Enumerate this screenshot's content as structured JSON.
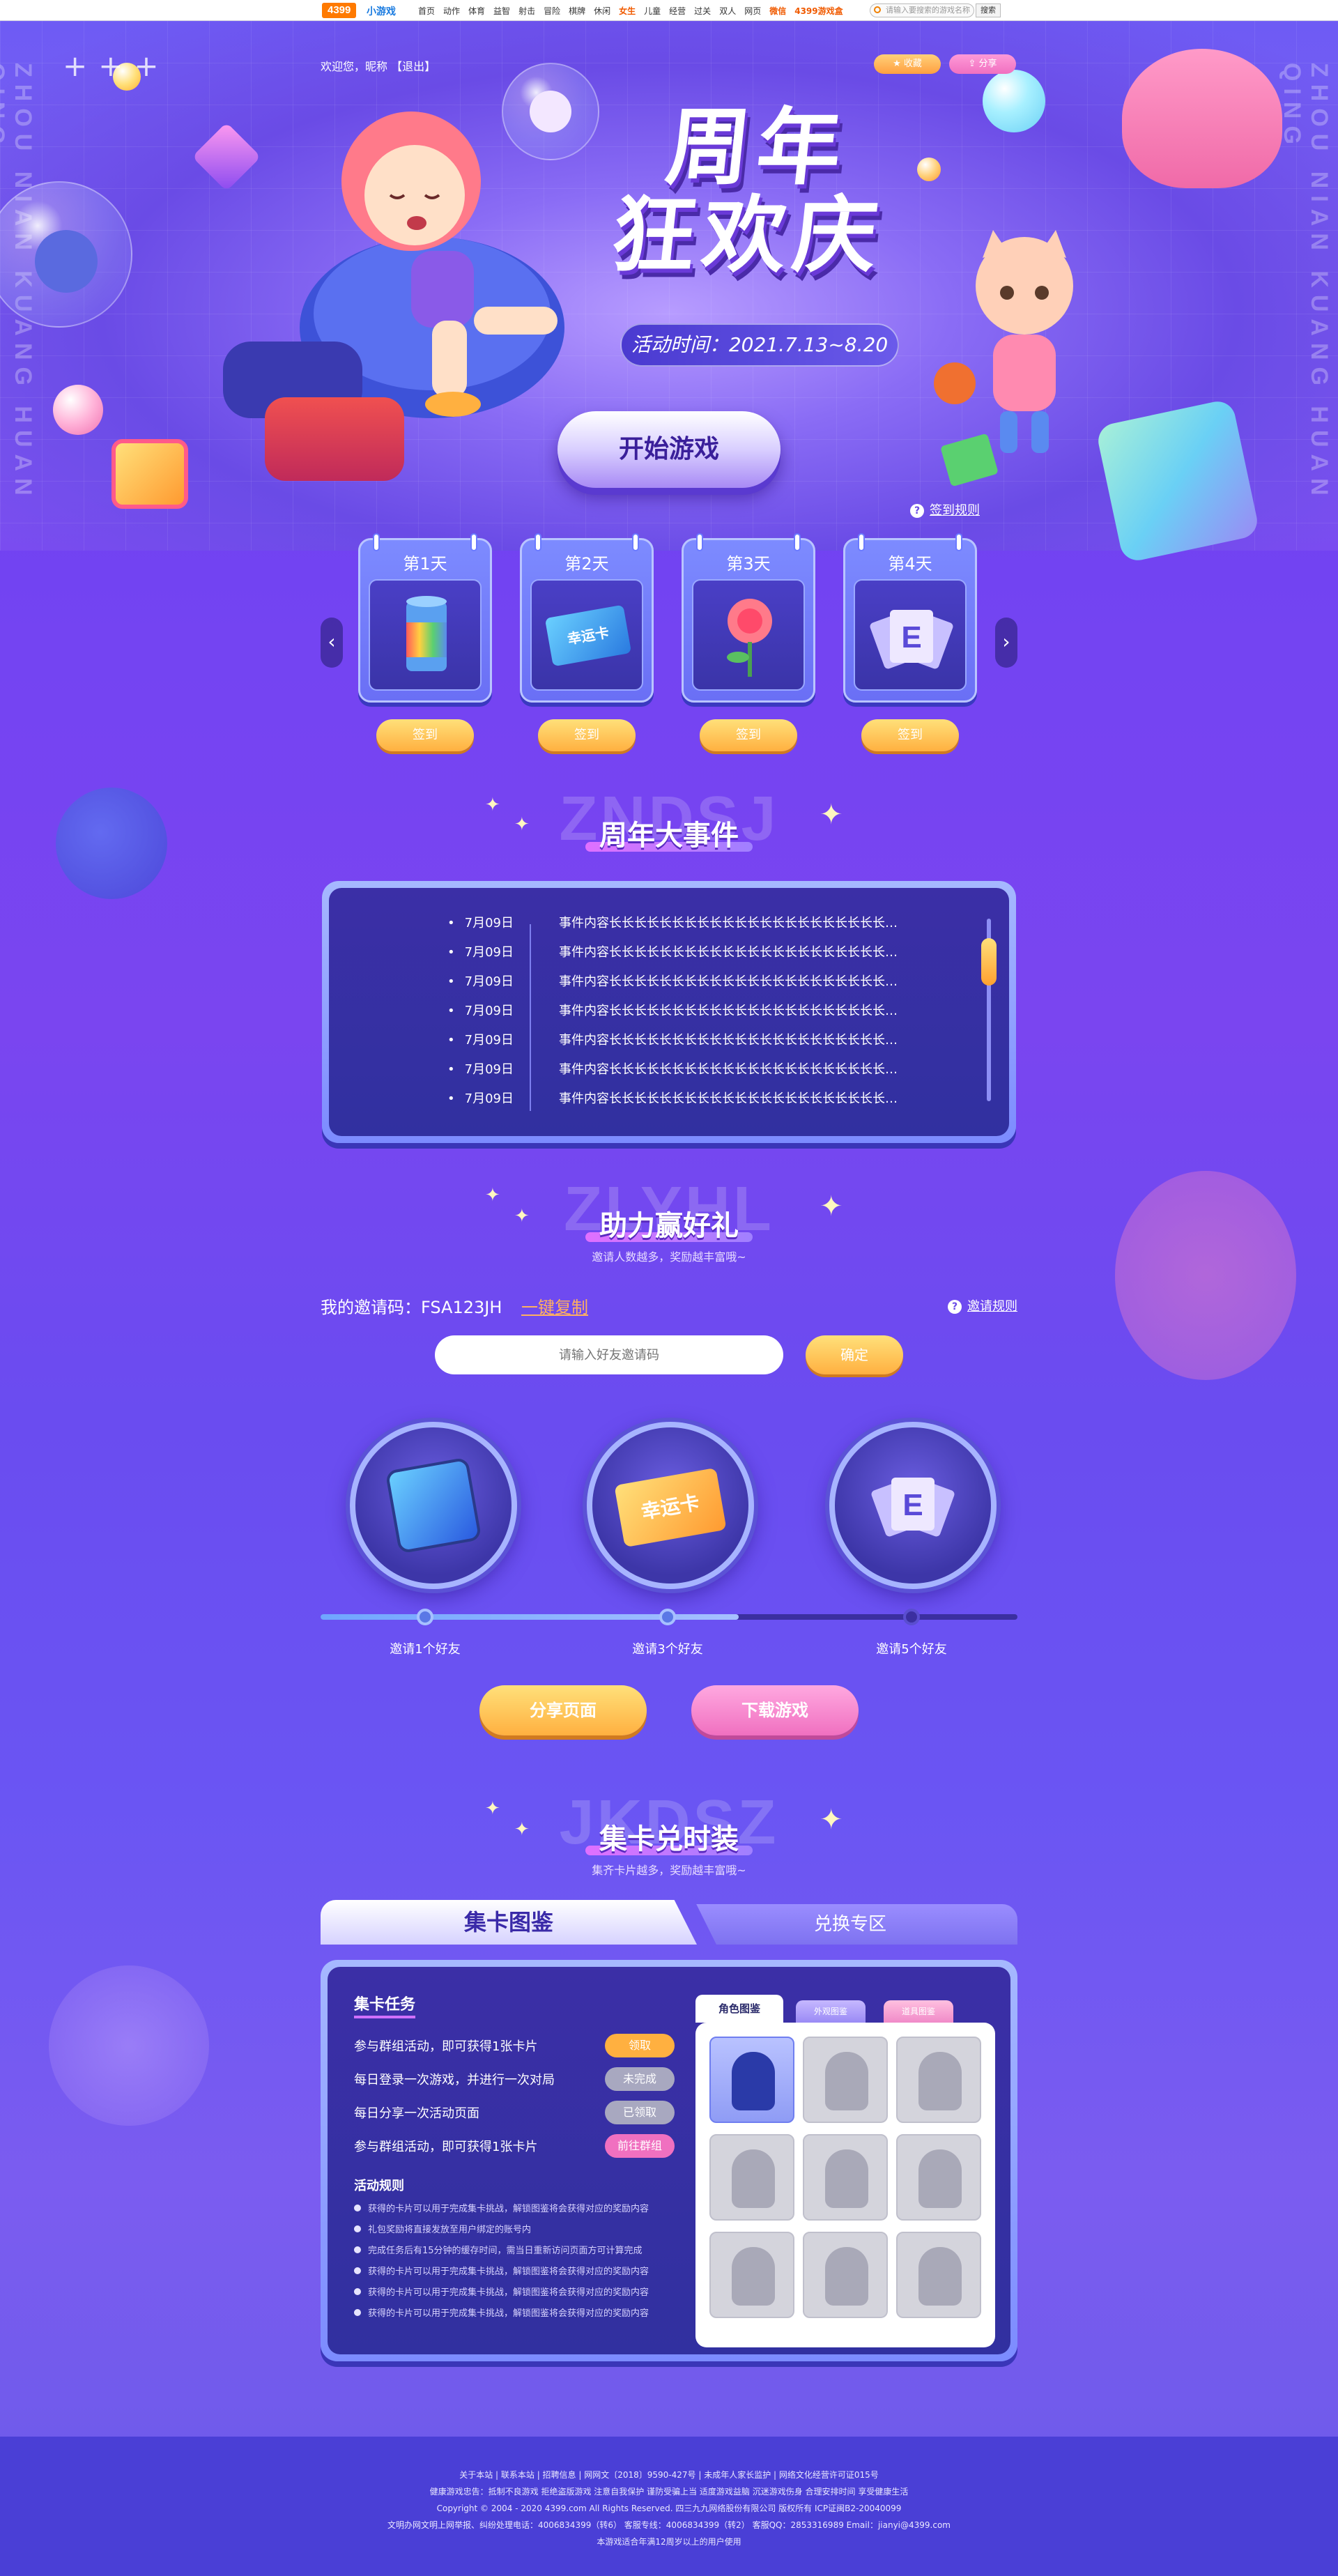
{
  "sitebar": {
    "logo": "4399",
    "logo_sub": "小游戏",
    "nav": [
      "首页",
      "动作",
      "体育",
      "益智",
      "射击",
      "冒险",
      "棋牌",
      "休闲",
      "女生",
      "儿童",
      "经营",
      "过关",
      "双人",
      "网页",
      "微信",
      "4399游戏盒"
    ],
    "search_placeholder": "请输入要搜索的游戏名称",
    "search_button": "搜索"
  },
  "hero": {
    "welcome": "欢迎您，昵称 【退出】",
    "fav_label": "收藏",
    "share_label": "分享",
    "title_line1": "周年",
    "title_line2": "狂欢庆",
    "date": "活动时间：2021.7.13~8.20",
    "start_button": "开始游戏",
    "side_left": "ZHOU NIAN KUANG HUAN QING",
    "side_right": "ZHOU NIAN KUANG HUAN QING"
  },
  "signin": {
    "rule_link": "签到规则",
    "days": [
      {
        "label": "第1天",
        "icon": "paint-can-icon",
        "button": "签到"
      },
      {
        "label": "第2天",
        "icon": "lucky-card-icon",
        "button": "签到"
      },
      {
        "label": "第3天",
        "icon": "rose-icon",
        "button": "签到"
      },
      {
        "label": "第4天",
        "icon": "e-cards-icon",
        "button": "签到"
      }
    ],
    "lucky_text": "幸运卡"
  },
  "events": {
    "ghost": "ZNDSJ",
    "title": "周年大事件",
    "rows": [
      {
        "date": "7月09日",
        "text": "事件内容长长长长长长长长长长长长长长长长长长长长长长长长长长长长长长"
      },
      {
        "date": "7月09日",
        "text": "事件内容长长长长长长长长长长长长长长长长长长长长长长长长长长长长长长"
      },
      {
        "date": "7月09日",
        "text": "事件内容长长长长长长长长长长长长长长长长长长长长长长长长长长长长长长"
      },
      {
        "date": "7月09日",
        "text": "事件内容长长长长长长长长长长长长长长长长长长长长长长长长长长长长长长"
      },
      {
        "date": "7月09日",
        "text": "事件内容长长长长长长长长长长长长长长长长长长长长长长长长长长长长长长"
      },
      {
        "date": "7月09日",
        "text": "事件内容长长长长长长长长长长长长长长长长长长长长长长长长长长长长长长"
      },
      {
        "date": "7月09日",
        "text": "事件内容长长长长长长长长长长长长长长长长长长长长长长长长长长长长长长"
      }
    ]
  },
  "invite": {
    "ghost": "ZLYHL",
    "title": "助力赢好礼",
    "subtitle": "邀请人数越多，奖励越丰富哦~",
    "code_text": "我的邀请码：FSA123JH",
    "copy_label": "一键复制",
    "rule_link": "邀请规则",
    "input_placeholder": "请输入好友邀请码",
    "confirm_label": "确定",
    "rewards": [
      {
        "icon": "blue-card-box-icon",
        "label": "邀请1个好友"
      },
      {
        "icon": "lucky-card-icon",
        "label": "邀请3个好友"
      },
      {
        "icon": "e-cards-icon",
        "label": "邀请5个好友"
      }
    ],
    "progress": 0.6,
    "share_button": "分享页面",
    "download_button": "下载游戏"
  },
  "cards": {
    "ghost": "JKDSZ",
    "title": "集卡兑时装",
    "subtitle": "集齐卡片越多，奖励越丰富哦~",
    "tab_active": "集卡图鉴",
    "tab_inactive": "兑换专区",
    "task_title": "集卡任务",
    "tasks": [
      {
        "text": "参与群组活动，即可获得1张卡片",
        "button": "领取",
        "color": "#ffb040"
      },
      {
        "text": "每日登录一次游戏，并进行一次对局",
        "button": "未完成",
        "color": "#a8a8c0"
      },
      {
        "text": "每日分享一次活动页面",
        "button": "已领取",
        "color": "#a8a8c0"
      },
      {
        "text": "参与群组活动，即可获得1张卡片",
        "button": "前往群组",
        "color": "#f070c0"
      }
    ],
    "rules_title": "活动规则",
    "rules": [
      "获得的卡片可以用于完成集卡挑战，解锁图鉴将会获得对应的奖励内容",
      "礼包奖励将直接发放至用户绑定的账号内",
      "完成任务后有15分钟的缓存时间，需当日重新访问页面方可计算完成",
      "获得的卡片可以用于完成集卡挑战，解锁图鉴将会获得对应的奖励内容",
      "获得的卡片可以用于完成集卡挑战，解锁图鉴将会获得对应的奖励内容",
      "获得的卡片可以用于完成集卡挑战，解锁图鉴将会获得对应的奖励内容"
    ],
    "album_tabs": [
      "角色图鉴",
      "外观图鉴",
      "道具图鉴"
    ],
    "slots_collected": 1,
    "slots_total": 9
  },
  "footer": {
    "lines": [
      "关于本站 | 联系本站 | 招聘信息 | 网网文〔2018〕9590-427号 | 未成年人家长监护 | 网络文化经营许可证015号",
      "健康游戏忠告：抵制不良游戏 拒绝盗版游戏 注意自我保护 谨防受骗上当 适度游戏益脑 沉迷游戏伤身 合理安排时间 享受健康生活",
      "Copyright © 2004 - 2020 4399.com All Rights Reserved. 四三九九网络股份有限公司 版权所有 ICP证闽B2-20040099",
      "文明办网文明上网举报、纠纷处理电话：4006834399（转6）  客服专线：4006834399（转2）  客服QQ：2853316989  Email：jianyi@4399.com",
      "本游戏适合年满12周岁以上的用户使用"
    ]
  },
  "colors": {
    "accent_gold": "#ffb040",
    "accent_pink": "#f070c0",
    "panel_dark": "#3b2fa6"
  }
}
